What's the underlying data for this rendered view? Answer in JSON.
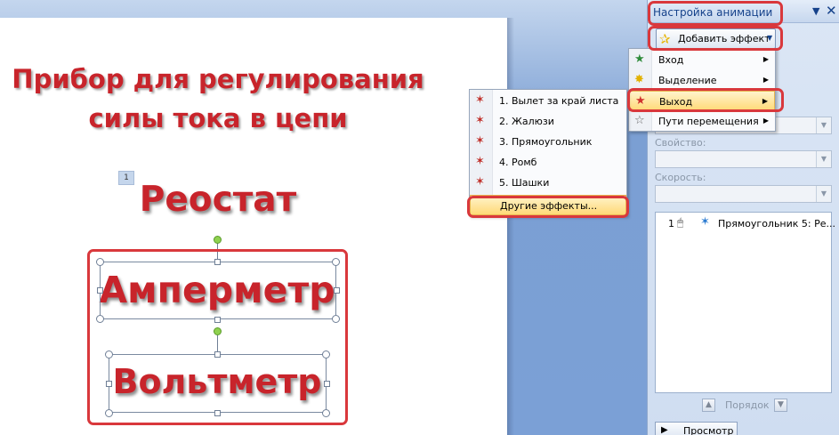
{
  "slide": {
    "title_line1": "Прибор для регулирования",
    "title_line2": "силы тока в цепи",
    "anim_tag": "1",
    "rheostat": "Реостат",
    "ammeter": "Амперметр",
    "voltmeter": "Вольтметр"
  },
  "pane": {
    "title": "Настройка анимации",
    "menu_icon": "▼",
    "close_icon": "✕",
    "add_effect_label": "Добавить эффект",
    "property_label": "Свойство:",
    "speed_label": "Скорость:",
    "effect_list": [
      {
        "num": "1",
        "name": "Прямоугольник 5: Ре..."
      }
    ],
    "order_label": "Порядок",
    "preview_label": "Просмотр"
  },
  "add_effect_menu": {
    "items": [
      {
        "label": "Вход",
        "icon": "entrance-star-icon",
        "color": "#2e8b3a"
      },
      {
        "label": "Выделение",
        "icon": "emphasis-star-icon",
        "color": "#e2b100"
      },
      {
        "label": "Выход",
        "icon": "exit-star-icon",
        "color": "#d0312d",
        "highlighted": true
      },
      {
        "label": "Пути перемещения",
        "icon": "motion-path-star-icon",
        "color": "#666666"
      }
    ]
  },
  "exit_submenu": {
    "items": [
      {
        "label": "1. Вылет за край листа"
      },
      {
        "label": "2. Жалюзи"
      },
      {
        "label": "3. Прямоугольник"
      },
      {
        "label": "4. Ромб"
      },
      {
        "label": "5. Шашки"
      },
      {
        "label": "Другие эффекты...",
        "highlighted": true
      }
    ]
  },
  "colors": {
    "title_red": "#c8242b",
    "highlight_frame": "#d9383c",
    "pane_text": "#15428b",
    "menu_hover": "#ffd977"
  }
}
